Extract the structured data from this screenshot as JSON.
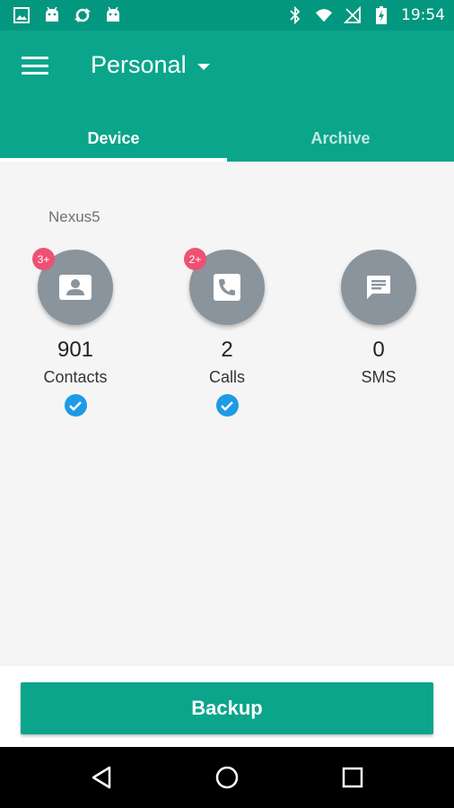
{
  "status_bar": {
    "time": "19:54",
    "left_icons": [
      "image-icon",
      "android-icon",
      "sync-icon",
      "android-icon"
    ],
    "right_icons": [
      "bluetooth-icon",
      "wifi-icon",
      "no-signal-icon",
      "battery-charging-icon"
    ]
  },
  "app_bar": {
    "account": "Personal",
    "tabs": [
      {
        "label": "Device",
        "selected": true
      },
      {
        "label": "Archive",
        "selected": false
      }
    ]
  },
  "device": {
    "name": "Nexus5",
    "stats": [
      {
        "badge": "3+",
        "count": "901",
        "label": "Contacts",
        "checked": true,
        "icon": "contact-card-icon"
      },
      {
        "badge": "2+",
        "count": "2",
        "label": "Calls",
        "checked": true,
        "icon": "phone-icon"
      },
      {
        "badge": "",
        "count": "0",
        "label": "SMS",
        "checked": false,
        "icon": "message-icon"
      }
    ]
  },
  "actions": {
    "backup_label": "Backup"
  },
  "colors": {
    "status_bar": "#04977f",
    "primary": "#0aa58b",
    "badge": "#ef5073",
    "check": "#1e9be6",
    "icon_circle": "#8a949d"
  }
}
